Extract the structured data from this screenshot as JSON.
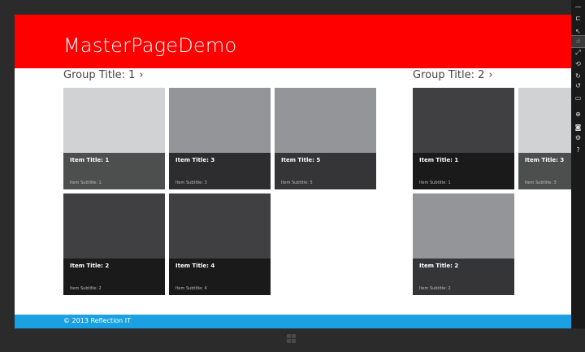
{
  "app": {
    "title": "MasterPageDemo"
  },
  "groups": [
    {
      "title": "Group Title: 1",
      "chevron": "›",
      "items": [
        {
          "title": "Item Title: 1",
          "subtitle": "Item Subtitle: 1",
          "image_color": "#d1d2d4",
          "caption_color": "#4d4f4e"
        },
        {
          "title": "Item Title: 3",
          "subtitle": "Item Subtitle: 3",
          "image_color": "#939598",
          "caption_color": "#2d2d2f"
        },
        {
          "title": "Item Title: 5",
          "subtitle": "Item Subtitle: 5",
          "image_color": "#939598",
          "caption_color": "#353537"
        },
        {
          "title": "Item Title: 2",
          "subtitle": "Item Subtitle: 2",
          "image_color": "#404042",
          "caption_color": "#1a1a1a"
        },
        {
          "title": "Item Title: 4",
          "subtitle": "Item Subtitle: 4",
          "image_color": "#404042",
          "caption_color": "#1a1a1a"
        }
      ]
    },
    {
      "title": "Group Title: 2",
      "chevron": "›",
      "items": [
        {
          "title": "Item Title: 1",
          "subtitle": "Item Subtitle: 1",
          "image_color": "#404042",
          "caption_color": "#1a1a1a"
        },
        {
          "title": "Item Title: 3",
          "subtitle": "Item Subtitle: 3",
          "image_color": "#d1d2d4",
          "caption_color": "#4d4f4e"
        },
        {
          "title": "Item Title: 2",
          "subtitle": "Item Subtitle: 2",
          "image_color": "#939598",
          "caption_color": "#353537"
        }
      ]
    }
  ],
  "footer": {
    "text": "© 2013 Reflection IT"
  },
  "colors": {
    "header": "#ff0000",
    "footer": "#1ba1e2",
    "background": "#ffffff"
  },
  "toolbar": {
    "icons": [
      "minimize-icon",
      "pin-icon",
      "mouse-mode-icon",
      "touch-mode-icon",
      "pinch-zoom-icon",
      "rotate-touch-icon",
      "rotate-clockwise-icon",
      "rotate-counterclockwise-icon",
      "change-resolution-icon",
      "set-location-icon",
      "screenshot-icon",
      "settings-icon",
      "help-icon"
    ],
    "glyphs": [
      "—",
      "⊏",
      "↖",
      "☝",
      "⤢",
      "⟲",
      "↻",
      "↺",
      "▭",
      "⊕",
      "◙",
      "⚙",
      "?"
    ],
    "active_index": 3
  }
}
